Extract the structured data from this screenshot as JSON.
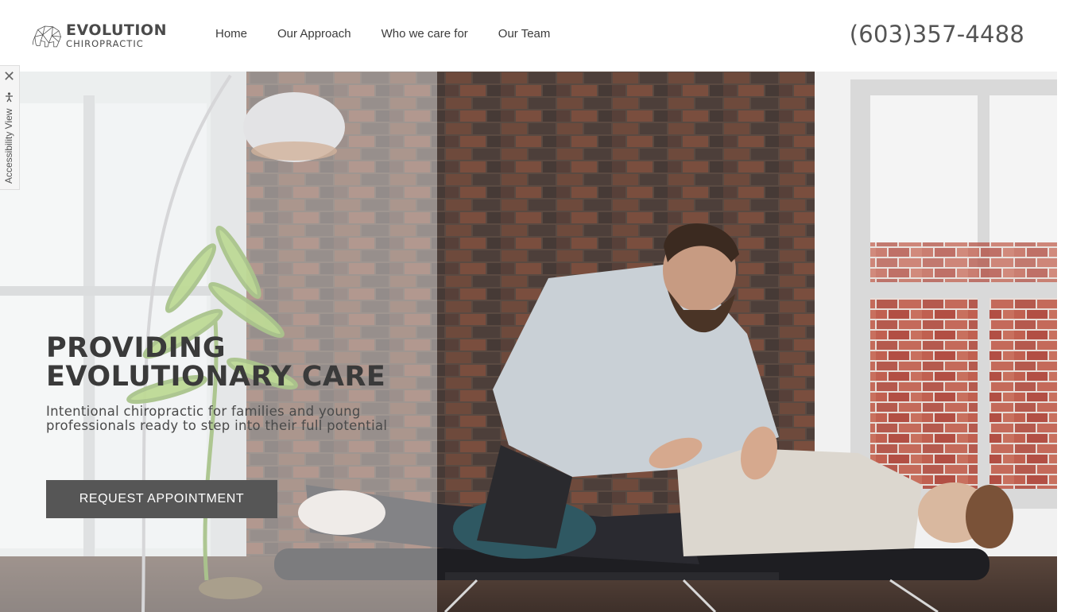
{
  "logo": {
    "line1": "EVOLUTION",
    "line2": "CHIROPRACTIC"
  },
  "nav": {
    "items": [
      {
        "label": "Home"
      },
      {
        "label": "Our Approach"
      },
      {
        "label": "Who we care for"
      },
      {
        "label": "Our Team"
      }
    ]
  },
  "phone": "(603)357-4488",
  "accessibility": {
    "close": "✕",
    "label": "Accessibility View"
  },
  "hero": {
    "title_line1": "PROVIDING",
    "title_line2": "EVOLUTIONARY CARE",
    "subtitle_line1": "Intentional chiropractic for families and young",
    "subtitle_line2": "professionals ready to step into their full potential",
    "cta": "REQUEST APPOINTMENT"
  },
  "colors": {
    "cta_bg": "#565656",
    "text_dark": "#3a3a3a",
    "phone": "#555555"
  }
}
